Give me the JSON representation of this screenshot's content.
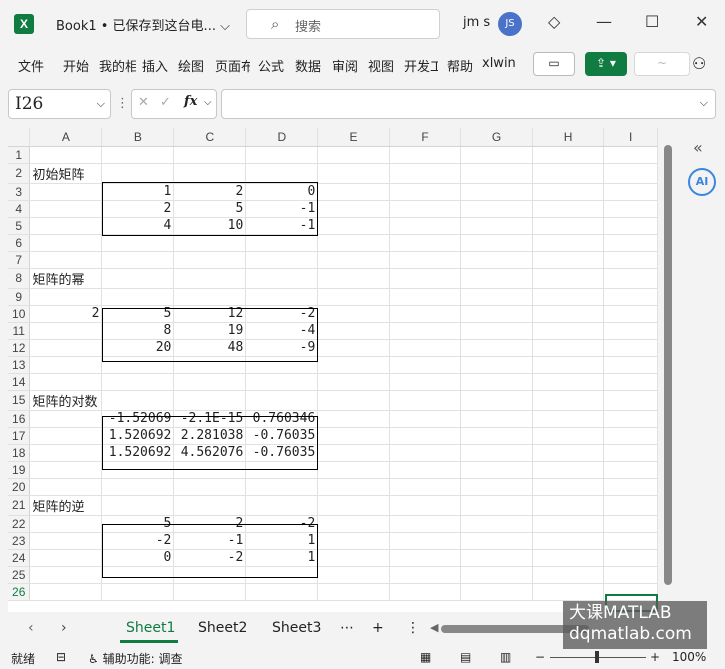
{
  "window": {
    "title": "Book1 • 已保存到这台电...",
    "search_placeholder": "搜索",
    "user_name": "jm s",
    "user_initials": "JS"
  },
  "ribbon": {
    "tabs": [
      "文件",
      "开始",
      "我的相",
      "插入",
      "绘图",
      "页面布",
      "公式",
      "数据",
      "审阅",
      "视图",
      "开发工",
      "帮助",
      "xlwin"
    ]
  },
  "formula_bar": {
    "name_box": "I26",
    "formula": ""
  },
  "grid": {
    "columns": [
      "A",
      "B",
      "C",
      "D",
      "E",
      "F",
      "G",
      "H",
      "I"
    ],
    "rows": [
      {
        "n": "1",
        "cells": [
          "",
          "",
          "",
          ""
        ]
      },
      {
        "n": "2",
        "cells": [
          "初始矩阵",
          "",
          "",
          ""
        ]
      },
      {
        "n": "3",
        "cells": [
          "",
          "1",
          "2",
          "0"
        ]
      },
      {
        "n": "4",
        "cells": [
          "",
          "2",
          "5",
          "-1"
        ]
      },
      {
        "n": "5",
        "cells": [
          "",
          "4",
          "10",
          "-1"
        ]
      },
      {
        "n": "6",
        "cells": [
          "",
          "",
          "",
          ""
        ]
      },
      {
        "n": "7",
        "cells": [
          "",
          "",
          "",
          ""
        ]
      },
      {
        "n": "8",
        "cells": [
          "矩阵的幂",
          "",
          "",
          ""
        ]
      },
      {
        "n": "9",
        "cells": [
          "",
          "",
          "",
          ""
        ]
      },
      {
        "n": "10",
        "cells": [
          "2",
          "5",
          "12",
          "-2"
        ]
      },
      {
        "n": "11",
        "cells": [
          "",
          "8",
          "19",
          "-4"
        ]
      },
      {
        "n": "12",
        "cells": [
          "",
          "20",
          "48",
          "-9"
        ]
      },
      {
        "n": "13",
        "cells": [
          "",
          "",
          "",
          ""
        ]
      },
      {
        "n": "14",
        "cells": [
          "",
          "",
          "",
          ""
        ]
      },
      {
        "n": "15",
        "cells": [
          "矩阵的对数",
          "",
          "",
          ""
        ]
      },
      {
        "n": "16",
        "cells": [
          "",
          "-1.52069",
          "-2.1E-15",
          "0.760346"
        ]
      },
      {
        "n": "17",
        "cells": [
          "",
          "1.520692",
          "2.281038",
          "-0.76035"
        ]
      },
      {
        "n": "18",
        "cells": [
          "",
          "1.520692",
          "4.562076",
          "-0.76035"
        ]
      },
      {
        "n": "19",
        "cells": [
          "",
          "",
          "",
          ""
        ]
      },
      {
        "n": "20",
        "cells": [
          "",
          "",
          "",
          ""
        ]
      },
      {
        "n": "21",
        "cells": [
          "矩阵的逆",
          "",
          "",
          ""
        ]
      },
      {
        "n": "22",
        "cells": [
          "",
          "5",
          "2",
          "-2"
        ]
      },
      {
        "n": "23",
        "cells": [
          "",
          "-2",
          "-1",
          "1"
        ]
      },
      {
        "n": "24",
        "cells": [
          "",
          "0",
          "-2",
          "1"
        ]
      },
      {
        "n": "25",
        "cells": [
          "",
          "",
          "",
          ""
        ]
      },
      {
        "n": "26",
        "cells": [
          "",
          "",
          "",
          ""
        ]
      }
    ]
  },
  "sheets": [
    "Sheet1",
    "Sheet2",
    "Sheet3"
  ],
  "status": {
    "ready": "就绪",
    "accessibility": "辅助功能: 调查",
    "zoom": "100%"
  },
  "watermark": {
    "line1": "大课MATLAB",
    "line2": "dqmatlab.com"
  },
  "colors": {
    "accent": "#107c41",
    "avatar": "#4a72c9",
    "ai": "#3a86e0"
  }
}
